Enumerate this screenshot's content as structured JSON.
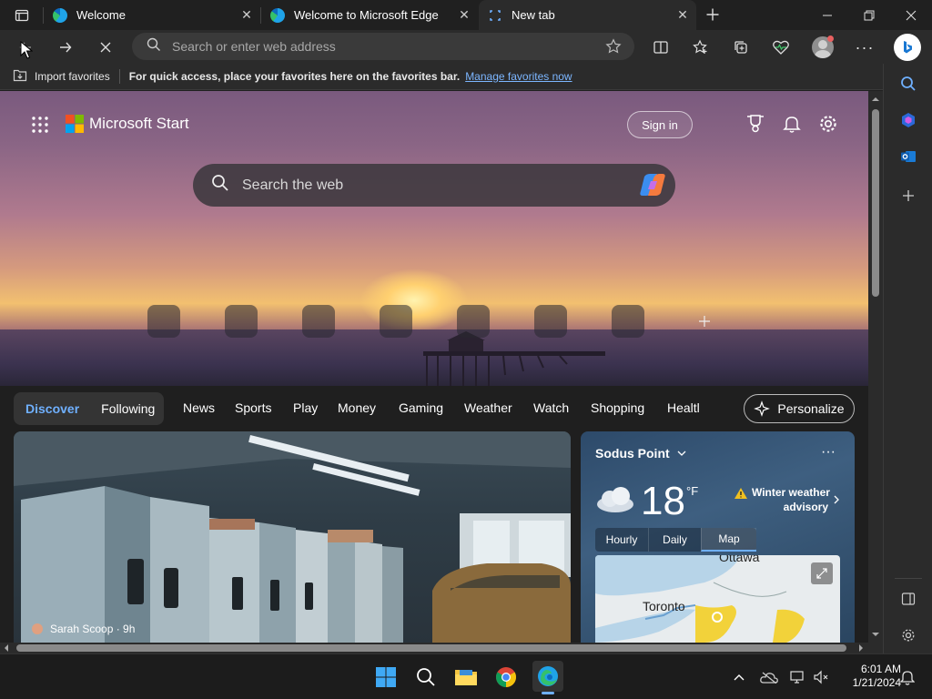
{
  "tabs": [
    {
      "title": "Welcome"
    },
    {
      "title": "Welcome to Microsoft Edge"
    },
    {
      "title": "New tab"
    }
  ],
  "toolbar": {
    "address_placeholder": "Search or enter web address"
  },
  "favorites_bar": {
    "import_label": "Import favorites",
    "message": "For quick access, place your favorites here on the favorites bar.",
    "manage_link": "Manage favorites now"
  },
  "hero": {
    "brand": "Microsoft Start",
    "sign_in": "Sign in",
    "search_placeholder": "Search the web"
  },
  "nav": {
    "discover": "Discover",
    "following": "Following",
    "items": [
      "News",
      "Sports",
      "Play",
      "Money",
      "Gaming",
      "Weather",
      "Watch",
      "Shopping",
      "Healtl"
    ],
    "personalize": "Personalize"
  },
  "news_card": {
    "source": "Sarah Scoop · 9h"
  },
  "weather": {
    "location": "Sodus Point",
    "temperature": "18",
    "unit": "°F",
    "alert_line1": "Winter weather",
    "alert_line2": "advisory",
    "tabs": [
      "Hourly",
      "Daily",
      "Map"
    ],
    "map_labels": {
      "city1": "Toronto",
      "city2": "Ottawa"
    }
  },
  "taskbar": {
    "time": "6:01 AM",
    "date": "1/21/2024"
  },
  "colors": {
    "accent_link": "#7cb6ff",
    "discover_blue": "#6fb0ff",
    "edge_blue": "#1fa3e8",
    "window_bg": "#202020"
  }
}
